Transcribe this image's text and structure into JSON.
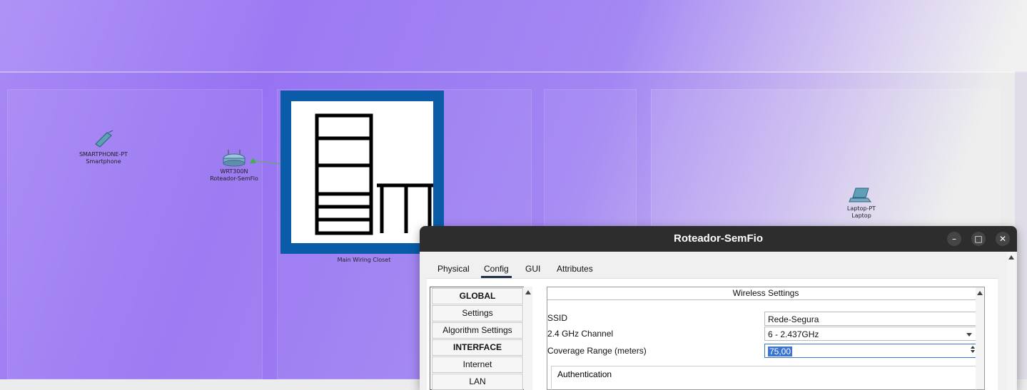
{
  "workspace": {
    "devices": {
      "smartphone": {
        "model": "SMARTPHONE-PT",
        "name": "Smartphone"
      },
      "router": {
        "model": "WRT300N",
        "name": "Roteador-SemFio"
      },
      "laptop": {
        "model": "Laptop-PT",
        "name": "Laptop"
      }
    },
    "closet_label": "Main Wiring Closet"
  },
  "window": {
    "title": "Roteador-SemFio",
    "controls": {
      "minimize": "–",
      "maximize": "□",
      "close": "✕"
    },
    "tabs": [
      {
        "label": "Physical"
      },
      {
        "label": "Config",
        "active": true
      },
      {
        "label": "GUI"
      },
      {
        "label": "Attributes"
      }
    ]
  },
  "left_list": {
    "items": [
      {
        "label": "GLOBAL",
        "header": true
      },
      {
        "label": "Settings"
      },
      {
        "label": "Algorithm Settings"
      },
      {
        "label": "INTERFACE",
        "header": true
      },
      {
        "label": "Internet"
      },
      {
        "label": "LAN"
      }
    ]
  },
  "wireless": {
    "title": "Wireless Settings",
    "ssid_label": "SSID",
    "ssid_value": "Rede-Segura",
    "channel_label": "2.4 GHz Channel",
    "channel_value": "6 - 2.437GHz",
    "range_label": "Coverage Range (meters)",
    "range_value": "75,00",
    "auth_label": "Authentication"
  },
  "colors": {
    "closet_border": "#0a5ca8",
    "titlebar": "#2d2d2d",
    "selection": "#3a73d0"
  }
}
